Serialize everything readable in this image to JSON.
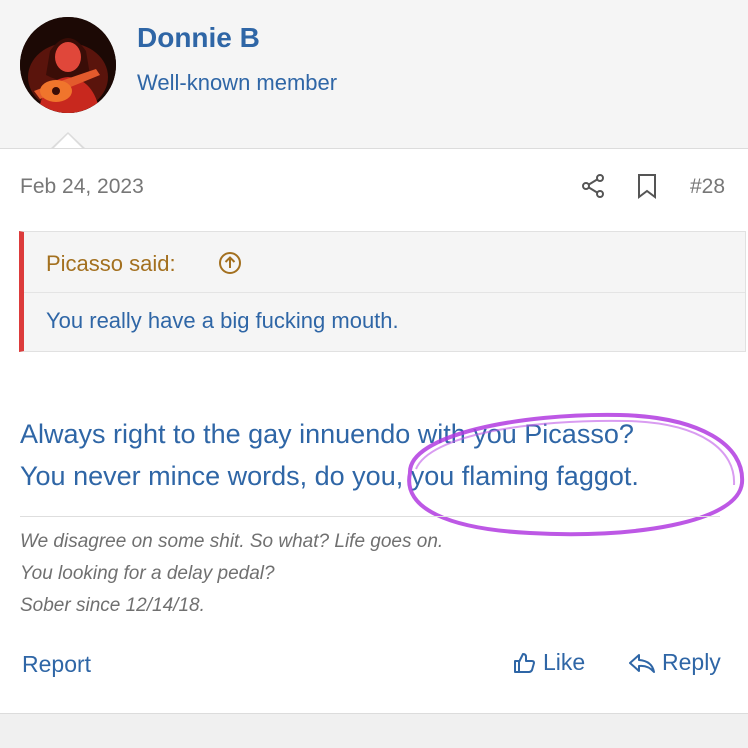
{
  "user": {
    "name": "Donnie B",
    "title": "Well-known member"
  },
  "post": {
    "date": "Feb 24, 2023",
    "number": "#28",
    "share_icon": "share-icon",
    "bookmark_icon": "bookmark-icon"
  },
  "quote": {
    "author": "Picasso said:",
    "text": "You really have a big fucking mouth.",
    "icon": "arrow-up-circle-icon"
  },
  "message": {
    "lines": [
      "Always right to the gay innuendo with you Picasso?",
      "You never mince words, do you, you flaming faggot."
    ]
  },
  "signature": {
    "lines": [
      "We disagree on some shit. So what? Life goes on.",
      "You looking for a delay pedal?",
      "Sober since 12/14/18."
    ]
  },
  "actions": {
    "report": "Report",
    "like": "Like",
    "reply": "Reply"
  },
  "colors": {
    "link": "#2f66a6",
    "quote_author": "#a3701f",
    "quote_bar": "#dc3b3b",
    "highlight_circle": "#b13be0"
  }
}
